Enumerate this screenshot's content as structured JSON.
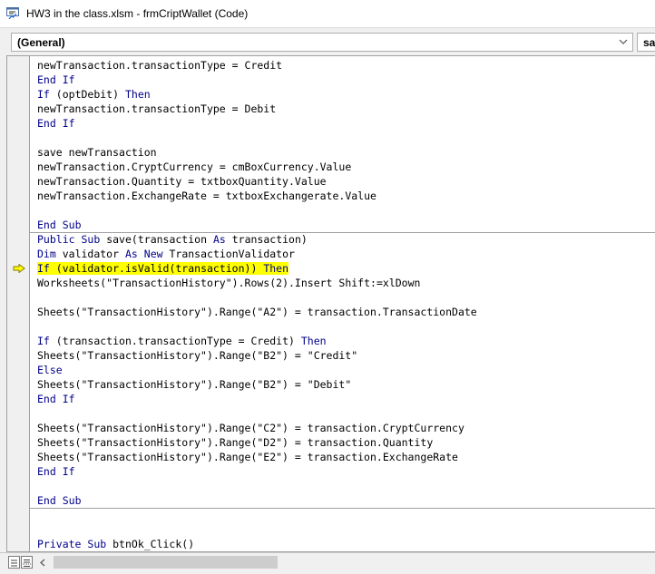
{
  "window": {
    "title": "HW3 in the class.xlsm - frmCriptWallet (Code)"
  },
  "toolbar": {
    "object_combo": "(General)",
    "procedure_combo": "save"
  },
  "code_lines": [
    [
      "newTransaction.transactionType = Credit"
    ],
    [
      "End If"
    ],
    [
      "If (optDebit) Then"
    ],
    [
      "newTransaction.transactionType = Debit"
    ],
    [
      "End If"
    ],
    [
      ""
    ],
    [
      "save newTransaction"
    ],
    [
      "newTransaction.CryptCurrency = cmBoxCurrency.Value"
    ],
    [
      "newTransaction.Quantity = txtboxQuantity.Value"
    ],
    [
      "newTransaction.ExchangeRate = txtboxExchangerate.Value"
    ],
    [
      ""
    ],
    [
      "End Sub"
    ],
    [
      "Public Sub save(transaction As transaction)"
    ],
    [
      "Dim validator As New TransactionValidator"
    ],
    [
      "If (validator.isValid(transaction)) Then"
    ],
    [
      "Worksheets(\"TransactionHistory\").Rows(2).Insert Shift:=xlDown"
    ],
    [
      ""
    ],
    [
      "Sheets(\"TransactionHistory\").Range(\"A2\") = transaction.TransactionDate"
    ],
    [
      ""
    ],
    [
      "If (transaction.transactionType = Credit) Then"
    ],
    [
      "Sheets(\"TransactionHistory\").Range(\"B2\") = \"Credit\""
    ],
    [
      "Else"
    ],
    [
      "Sheets(\"TransactionHistory\").Range(\"B2\") = \"Debit\""
    ],
    [
      "End If"
    ],
    [
      ""
    ],
    [
      "Sheets(\"TransactionHistory\").Range(\"C2\") = transaction.CryptCurrency"
    ],
    [
      "Sheets(\"TransactionHistory\").Range(\"D2\") = transaction.Quantity"
    ],
    [
      "Sheets(\"TransactionHistory\").Range(\"E2\") = transaction.ExchangeRate"
    ],
    [
      "End If"
    ],
    [
      ""
    ],
    [
      "End Sub"
    ],
    [
      ""
    ],
    [
      ""
    ],
    [
      "Private Sub btnOk_Click()"
    ]
  ],
  "highlighted_line": 14,
  "separators_after_line": [
    11,
    30
  ],
  "colors": {
    "keyword": "#00008b",
    "text": "#000000",
    "highlight": "#ffff00",
    "execution_arrow": "#ffff00"
  },
  "icons": {
    "window": "vba-code-window-icon",
    "combo_dropdown": "chevron-down-icon",
    "execution_pointer": "current-line-arrow-icon",
    "procedure_view": "procedure-view-icon",
    "full_module_view": "full-module-view-icon",
    "scroll_left": "scroll-left-arrow-icon"
  }
}
